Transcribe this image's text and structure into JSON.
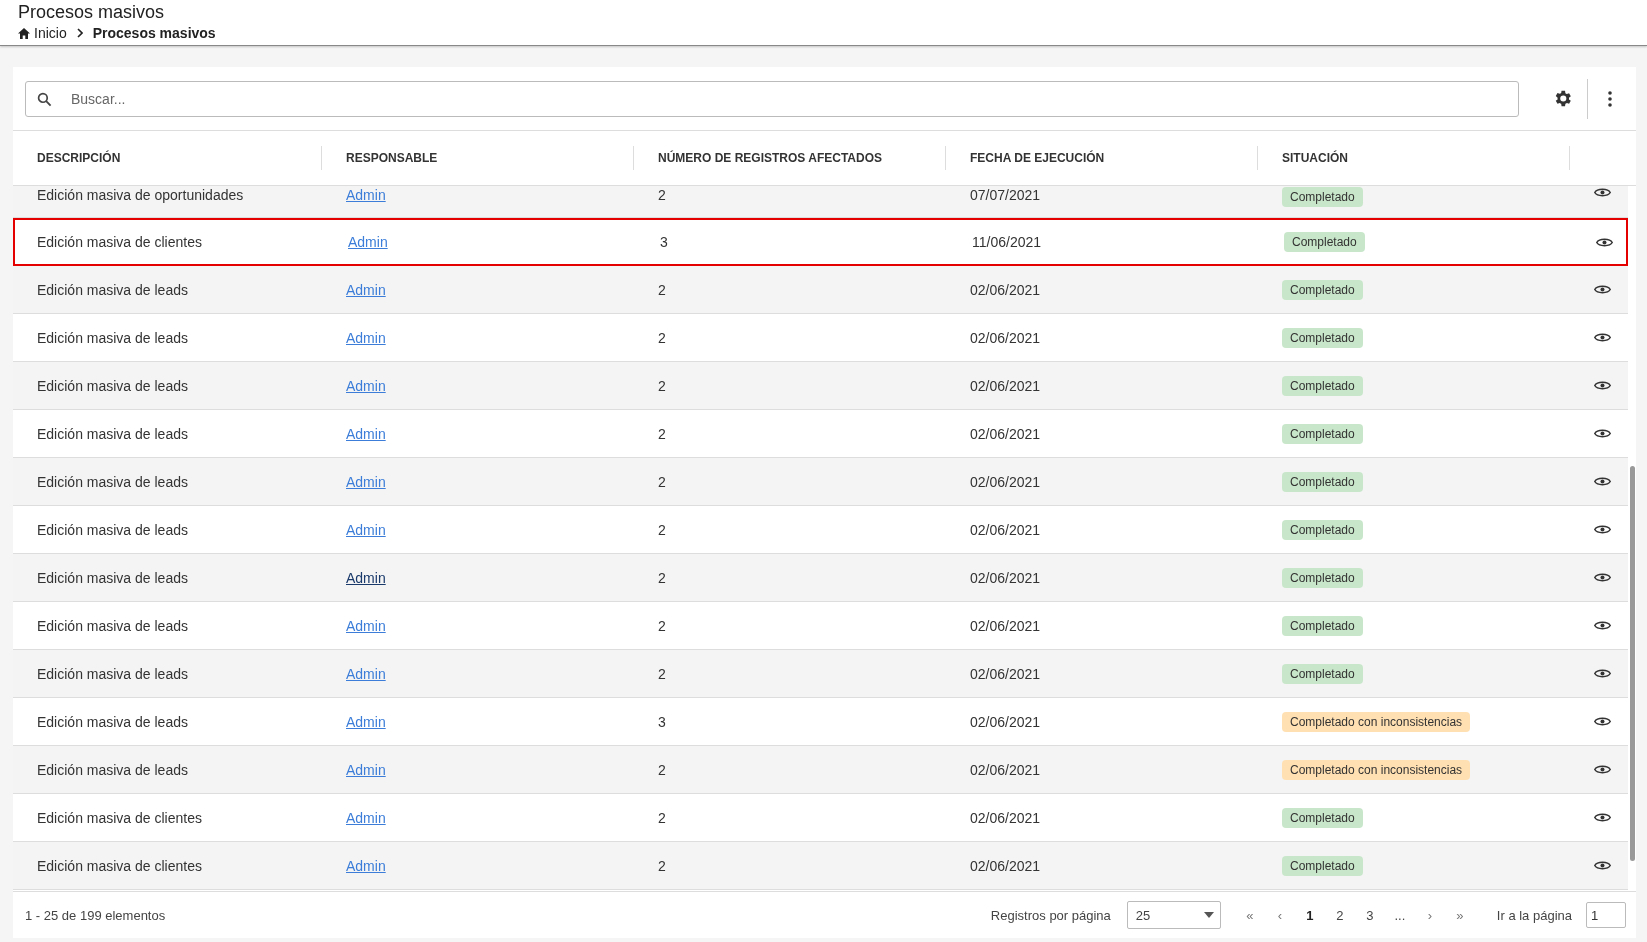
{
  "page": {
    "title": "Procesos masivos",
    "breadcrumb": [
      {
        "label": "Inicio",
        "current": false
      },
      {
        "label": "Procesos masivos",
        "current": true
      }
    ]
  },
  "search": {
    "placeholder": "Buscar..."
  },
  "table": {
    "columns": [
      "DESCRIPCIÓN",
      "RESPONSABLE",
      "NÚMERO DE REGISTROS AFECTADOS",
      "FECHA DE EJECUCIÓN",
      "SITUACIÓN"
    ],
    "rows": [
      {
        "description": "Edición masiva de oportunidades",
        "owner": "Admin",
        "count": "2",
        "date": "07/07/2021",
        "status": "Completado",
        "color": "#c8e6c9",
        "highlighted": false,
        "visited": false
      },
      {
        "description": "Edición masiva de clientes",
        "owner": "Admin",
        "count": "3",
        "date": "11/06/2021",
        "status": "Completado",
        "color": "#c8e6c9",
        "highlighted": true,
        "visited": false
      },
      {
        "description": "Edición masiva de leads",
        "owner": "Admin",
        "count": "2",
        "date": "02/06/2021",
        "status": "Completado",
        "color": "#c8e6c9",
        "highlighted": false,
        "visited": false
      },
      {
        "description": "Edición masiva de leads",
        "owner": "Admin",
        "count": "2",
        "date": "02/06/2021",
        "status": "Completado",
        "color": "#c8e6c9",
        "highlighted": false,
        "visited": false
      },
      {
        "description": "Edición masiva de leads",
        "owner": "Admin",
        "count": "2",
        "date": "02/06/2021",
        "status": "Completado",
        "color": "#c8e6c9",
        "highlighted": false,
        "visited": false
      },
      {
        "description": "Edición masiva de leads",
        "owner": "Admin",
        "count": "2",
        "date": "02/06/2021",
        "status": "Completado",
        "color": "#c8e6c9",
        "highlighted": false,
        "visited": false
      },
      {
        "description": "Edición masiva de leads",
        "owner": "Admin",
        "count": "2",
        "date": "02/06/2021",
        "status": "Completado",
        "color": "#c8e6c9",
        "highlighted": false,
        "visited": false
      },
      {
        "description": "Edición masiva de leads",
        "owner": "Admin",
        "count": "2",
        "date": "02/06/2021",
        "status": "Completado",
        "color": "#c8e6c9",
        "highlighted": false,
        "visited": false
      },
      {
        "description": "Edición masiva de leads",
        "owner": "Admin",
        "count": "2",
        "date": "02/06/2021",
        "status": "Completado",
        "color": "#c8e6c9",
        "highlighted": false,
        "visited": true
      },
      {
        "description": "Edición masiva de leads",
        "owner": "Admin",
        "count": "2",
        "date": "02/06/2021",
        "status": "Completado",
        "color": "#c8e6c9",
        "highlighted": false,
        "visited": false
      },
      {
        "description": "Edición masiva de leads",
        "owner": "Admin",
        "count": "2",
        "date": "02/06/2021",
        "status": "Completado",
        "color": "#c8e6c9",
        "highlighted": false,
        "visited": false
      },
      {
        "description": "Edición masiva de leads",
        "owner": "Admin",
        "count": "3",
        "date": "02/06/2021",
        "status": "Completado con inconsistencias",
        "color": "#ffe0b2",
        "highlighted": false,
        "visited": false
      },
      {
        "description": "Edición masiva de leads",
        "owner": "Admin",
        "count": "2",
        "date": "02/06/2021",
        "status": "Completado con inconsistencias",
        "color": "#ffe0b2",
        "highlighted": false,
        "visited": false
      },
      {
        "description": "Edición masiva de clientes",
        "owner": "Admin",
        "count": "2",
        "date": "02/06/2021",
        "status": "Completado",
        "color": "#c8e6c9",
        "highlighted": false,
        "visited": false
      },
      {
        "description": "Edición masiva de clientes",
        "owner": "Admin",
        "count": "2",
        "date": "02/06/2021",
        "status": "Completado",
        "color": "#c8e6c9",
        "highlighted": false,
        "visited": false
      }
    ]
  },
  "footer": {
    "summary": "1 - 25 de 199 elementos",
    "page_size_label": "Registros por página",
    "page_size": "25",
    "nav": [
      {
        "label": "«",
        "kind": "arrow",
        "selected": false
      },
      {
        "label": "‹",
        "kind": "arrow",
        "selected": false
      },
      {
        "label": "1",
        "kind": "page",
        "selected": true
      },
      {
        "label": "2",
        "kind": "page",
        "selected": false
      },
      {
        "label": "3",
        "kind": "page",
        "selected": false
      },
      {
        "label": "...",
        "kind": "page",
        "selected": false
      },
      {
        "label": "›",
        "kind": "arrow",
        "selected": false
      },
      {
        "label": "»",
        "kind": "arrow",
        "selected": false
      }
    ],
    "goto_label": "Ir a la página",
    "goto_value": "1"
  }
}
